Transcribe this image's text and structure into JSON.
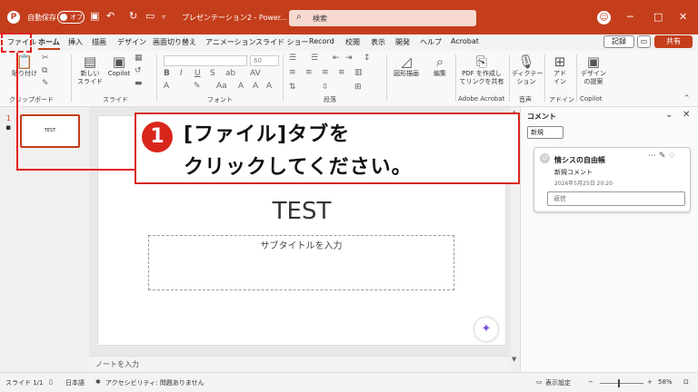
{
  "titlebar": {
    "autosave_label": "自動保存",
    "autosave_state": "オフ",
    "doc_name": "プレゼンテーション2 - Power...",
    "search_placeholder": "検索"
  },
  "tabs": [
    {
      "label": "ファイル"
    },
    {
      "label": "ホーム"
    },
    {
      "label": "挿入"
    },
    {
      "label": "描画"
    },
    {
      "label": "デザイン"
    },
    {
      "label": "画面切り替え"
    },
    {
      "label": "アニメーション"
    },
    {
      "label": "スライド ショー"
    },
    {
      "label": "Record"
    },
    {
      "label": "校閲"
    },
    {
      "label": "表示"
    },
    {
      "label": "開発"
    },
    {
      "label": "ヘルプ"
    },
    {
      "label": "Acrobat"
    }
  ],
  "tab_actions": {
    "record": "記録",
    "share": "共有"
  },
  "ribbon": {
    "paste": "貼り付け",
    "new_slide": "新しい\nスライド",
    "copilot": "Copilot",
    "font_size": "60",
    "drawing_shape": "図形描画",
    "edit": "編集",
    "pdf_share": "PDF を作成し\nてリンクを共有",
    "dictate": "ディクテー\nション",
    "addin": "アド\nイン",
    "designer": "デザイン\nの提案",
    "groups": {
      "clipboard": "クリップボード",
      "slide": "スライド",
      "font": "フォント",
      "paragraph": "段落",
      "acrobat": "Adobe Acrobat",
      "voice": "音声",
      "addin": "アドイン",
      "copilot": "Copilot"
    }
  },
  "thumbnail": {
    "number": "1",
    "text": "TEST"
  },
  "slide": {
    "title": "TEST",
    "subtitle_placeholder": "サブタイトルを入力"
  },
  "notes_placeholder": "ノートを入力",
  "comments": {
    "title": "コメント",
    "new_button": "新規",
    "card": {
      "author": "情シスの自由帳",
      "type": "新規コメント",
      "date": "2026年5月25日 20:20",
      "reply_placeholder": "返信"
    }
  },
  "statusbar": {
    "slide_pos": "スライド 1/1",
    "language": "日本語",
    "accessibility": "アクセシビリティ: 問題ありません",
    "view_settings": "表示設定",
    "zoom": "58%"
  },
  "callout": {
    "number": "①",
    "line1": "[ファイル]タブを",
    "line2": "クリックしてください。"
  },
  "colors": {
    "accent": "#c43e1c",
    "highlight_red": "#e31c1c"
  }
}
